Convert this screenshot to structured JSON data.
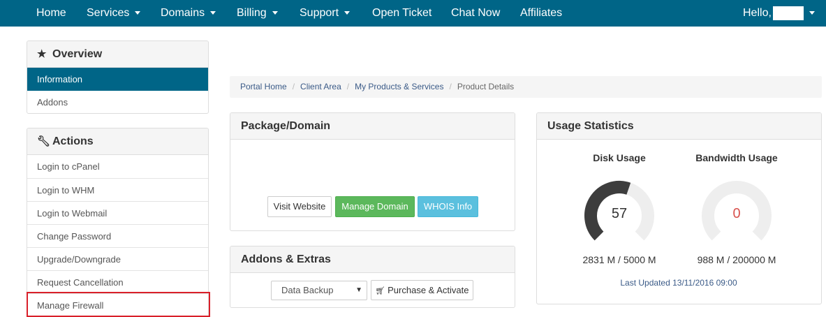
{
  "nav": {
    "home": "Home",
    "services": "Services",
    "domains": "Domains",
    "billing": "Billing",
    "support": "Support",
    "open_ticket": "Open Ticket",
    "chat_now": "Chat Now",
    "affiliates": "Affiliates",
    "hello": "Hello,"
  },
  "sidebar": {
    "overview": {
      "title": "Overview",
      "items": [
        "Information",
        "Addons"
      ]
    },
    "actions": {
      "title": "Actions",
      "items": [
        "Login to cPanel",
        "Login to WHM",
        "Login to Webmail",
        "Change Password",
        "Upgrade/Downgrade",
        "Request Cancellation",
        "Manage Firewall"
      ]
    }
  },
  "breadcrumb": [
    "Portal Home",
    "Client Area",
    "My Products & Services",
    "Product Details"
  ],
  "package": {
    "title": "Package/Domain",
    "visit_website": "Visit Website",
    "manage_domain": "Manage Domain",
    "whois_info": "WHOIS Info"
  },
  "addons": {
    "title": "Addons & Extras",
    "select_value": "Data Backup",
    "purchase": "Purchase & Activate"
  },
  "usage": {
    "title": "Usage Statistics",
    "disk": {
      "title": "Disk Usage",
      "percent": 57,
      "label": "57",
      "text": "2831 M / 5000 M"
    },
    "bandwidth": {
      "title": "Bandwidth Usage",
      "percent": 0,
      "label": "0",
      "text": "988 M / 200000 M"
    },
    "last_updated": "Last Updated 13/11/2016 09:00",
    "colors": {
      "track": "#eeeeee",
      "fill": "#3d3d3d",
      "zero_value": "#d9534f"
    }
  },
  "colors": {
    "nav_bg": "#006587",
    "highlight": "#d9202a"
  }
}
